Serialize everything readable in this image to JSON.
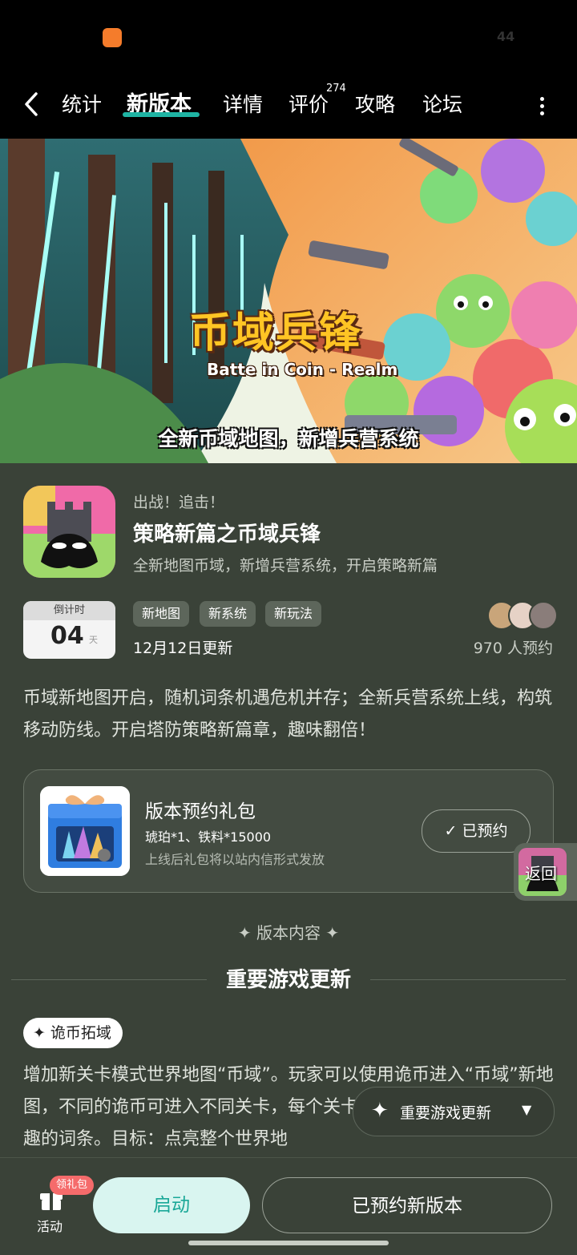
{
  "status": {
    "number": "44"
  },
  "nav": {
    "tabs": [
      {
        "label": "统计"
      },
      {
        "label": "新版本"
      },
      {
        "label": "详情"
      },
      {
        "label": "评价"
      },
      {
        "label": "攻略"
      },
      {
        "label": "论坛"
      }
    ],
    "review_count": "274"
  },
  "banner": {
    "title": "币域兵锋",
    "subtitle": "Batte in Coin - Realm",
    "caption": "全新币域地图，新增兵营系统"
  },
  "app": {
    "tagline": "出战！追击！",
    "title": "策略新篇之币域兵锋",
    "description": "全新地图币域，新增兵营系统，开启策略新篇"
  },
  "countdown": {
    "label": "倒计时",
    "value": "04",
    "unit": "天"
  },
  "tags": [
    "新地图",
    "新系统",
    "新玩法"
  ],
  "update_date": "12月12日更新",
  "reserve_count": "970 人预约",
  "intro": "币域新地图开启，随机词条机遇危机并存；全新兵营系统上线，构筑移动防线。开启塔防策略新篇章，趣味翻倍！",
  "gift": {
    "title": "版本预约礼包",
    "items": "琥珀*1、铁料*15000",
    "note": "上线后礼包将以站内信形式发放",
    "button": "已预约"
  },
  "float_back": {
    "label": "返回"
  },
  "section": {
    "kicker": "✦ 版本内容 ✦",
    "title": "重要游戏更新"
  },
  "feature": {
    "chip": "诡币拓域",
    "text": "增加新关卡模式世界地图“币域”。玩家可以使用诡币进入“币域”新地图，不同的诡币可进入不同关卡，每个关卡难度会被随机赋予一些有趣的词条。目标：点亮整个世界地"
  },
  "float_menu": {
    "label": "重要游戏更新"
  },
  "bottom": {
    "activity_label": "活动",
    "gift_badge": "领礼包",
    "launch": "启动",
    "reserved_version": "已预约新版本"
  },
  "colors": {
    "accent": "#1fb4a3",
    "page_bg": "#3a4238",
    "launch_text": "#1aa898"
  }
}
